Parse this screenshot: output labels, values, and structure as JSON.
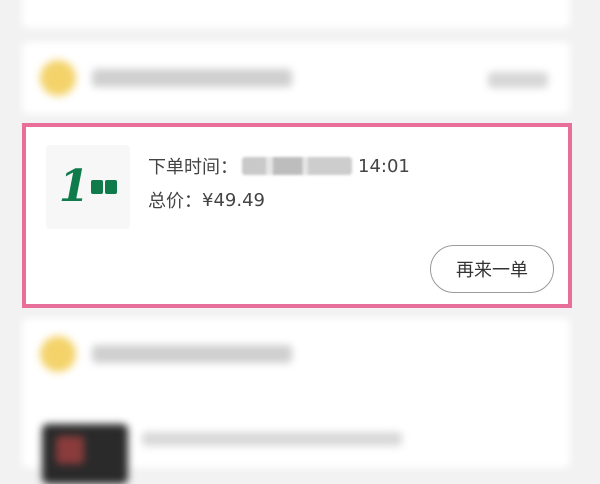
{
  "order": {
    "time_label": "下单时间：",
    "time_value": "14:01",
    "total_label": "总价：",
    "total_value": "¥49.49",
    "reorder_label": "再来一单"
  },
  "colors": {
    "highlight_border": "#e86f9a",
    "logo_green": "#0f7a4a",
    "shop_avatar": "#f4d36b"
  }
}
